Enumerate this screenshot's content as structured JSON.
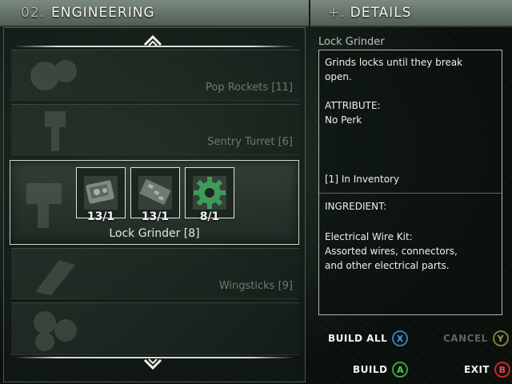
{
  "left_panel": {
    "number": "02.",
    "title": "ENGINEERING",
    "recipes": [
      {
        "name": "Pop Rockets [11]"
      },
      {
        "name": "Sentry Turret [6]"
      },
      {
        "name": "Wingsticks [9]"
      }
    ],
    "selected": {
      "name": "Lock Grinder [8]",
      "ingredients": [
        {
          "icon": "electrical-wire-kit-icon",
          "count": "13/1"
        },
        {
          "icon": "circuit-board-icon",
          "count": "13/1"
        },
        {
          "icon": "gear-icon",
          "count": "8/1"
        }
      ]
    }
  },
  "right_panel": {
    "number": "+.",
    "title": "DETAILS",
    "item_name": "Lock Grinder",
    "description_line1": "Grinds locks until they break",
    "description_line2": "open.",
    "attribute_label": "ATTRIBUTE:",
    "attribute_value": "No Perk",
    "inventory": "[1] In Inventory",
    "ingredient_label": "INGREDIENT:",
    "ingredient_name": "Electrical Wire Kit:",
    "ingredient_desc_line1": "Assorted wires, connectors,",
    "ingredient_desc_line2": "and other electrical parts."
  },
  "buttons": {
    "build_all": {
      "label": "BUILD ALL",
      "key": "X"
    },
    "cancel": {
      "label": "CANCEL",
      "key": "Y"
    },
    "build": {
      "label": "BUILD",
      "key": "A"
    },
    "exit": {
      "label": "EXIT",
      "key": "B"
    }
  },
  "colors": {
    "header": "#6b7a6f",
    "button_x": "#2f78c9",
    "button_y": "#7d7a35",
    "button_a": "#38a13c",
    "button_b": "#c22a2a"
  }
}
